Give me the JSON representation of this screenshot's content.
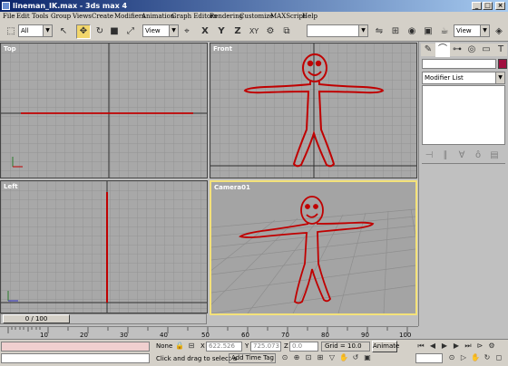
{
  "window": {
    "title": "lineman_IK.max - 3ds max 4"
  },
  "menu": [
    "File",
    "Edit",
    "Tools",
    "Group",
    "Views",
    "Create",
    "Modifiers",
    "Animation",
    "Graph Editors",
    "Rendering",
    "Customize",
    "MAXScript",
    "Help"
  ],
  "toolbar": {
    "selection_filter": "All",
    "reference_coord": "View",
    "axis_x": "X",
    "axis_y": "Y",
    "axis_z": "Z",
    "axis_xy": "XY",
    "named_sel_value": "",
    "view_right": "View"
  },
  "viewports": {
    "top": {
      "label": "Top"
    },
    "front": {
      "label": "Front"
    },
    "left": {
      "label": "Left"
    },
    "camera": {
      "label": "Camera01"
    }
  },
  "command_panel": {
    "modifier_list": "Modifier List"
  },
  "timeline": {
    "frame_display": "0 / 100",
    "ruler_ticks": [
      "10",
      "20",
      "30",
      "40",
      "50",
      "60",
      "70",
      "80",
      "90",
      "100"
    ]
  },
  "status": {
    "selection": "None",
    "x_label": "X",
    "x_value": "622.526",
    "y_label": "Y",
    "y_value": "725.073",
    "z_label": "Z",
    "z_value": "0.0",
    "grid": "Grid = 10.0",
    "prompt": "Click and drag to select a",
    "add_time_tag": "Add Time Tag",
    "animate": "Animate"
  },
  "colors": {
    "accent_active": "#f4e27a",
    "selected_spline": "#c00000",
    "title_bar": "#0a246a"
  }
}
